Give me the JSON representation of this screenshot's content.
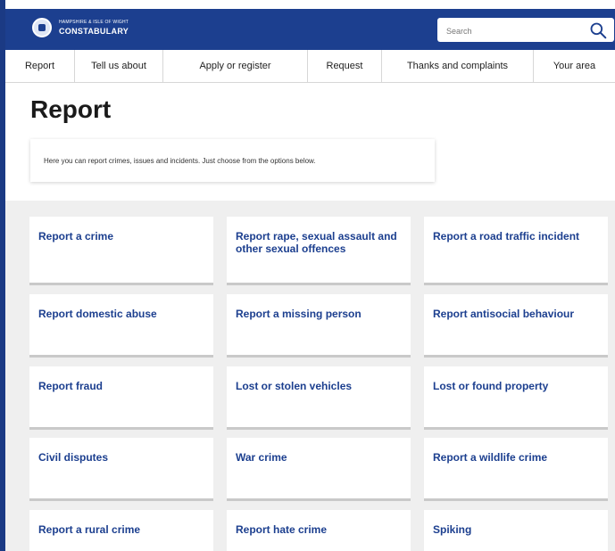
{
  "header": {
    "logo_small": "HAMPSHIRE & ISLE OF WIGHT",
    "logo_big": "CONSTABULARY",
    "search_placeholder": "Search"
  },
  "nav": [
    "Report",
    "Tell us about",
    "Apply or register",
    "Request",
    "Thanks and complaints",
    "Your area"
  ],
  "page": {
    "title": "Report",
    "intro": "Here you can report crimes, issues and incidents. Just choose from the options below."
  },
  "cards": [
    "Report a crime",
    "Report rape, sexual assault and other sexual offences",
    "Report a road traffic incident",
    "Report domestic abuse",
    "Report a missing person",
    "Report antisocial behaviour",
    "Report fraud",
    "Lost or stolen vehicles",
    "Lost or found property",
    "Civil disputes",
    "War crime",
    "Report a wildlife crime",
    "Report a rural crime",
    "Report hate crime",
    "Spiking"
  ],
  "colors": {
    "brand": "#1c3f8f",
    "background": "#efefef"
  }
}
